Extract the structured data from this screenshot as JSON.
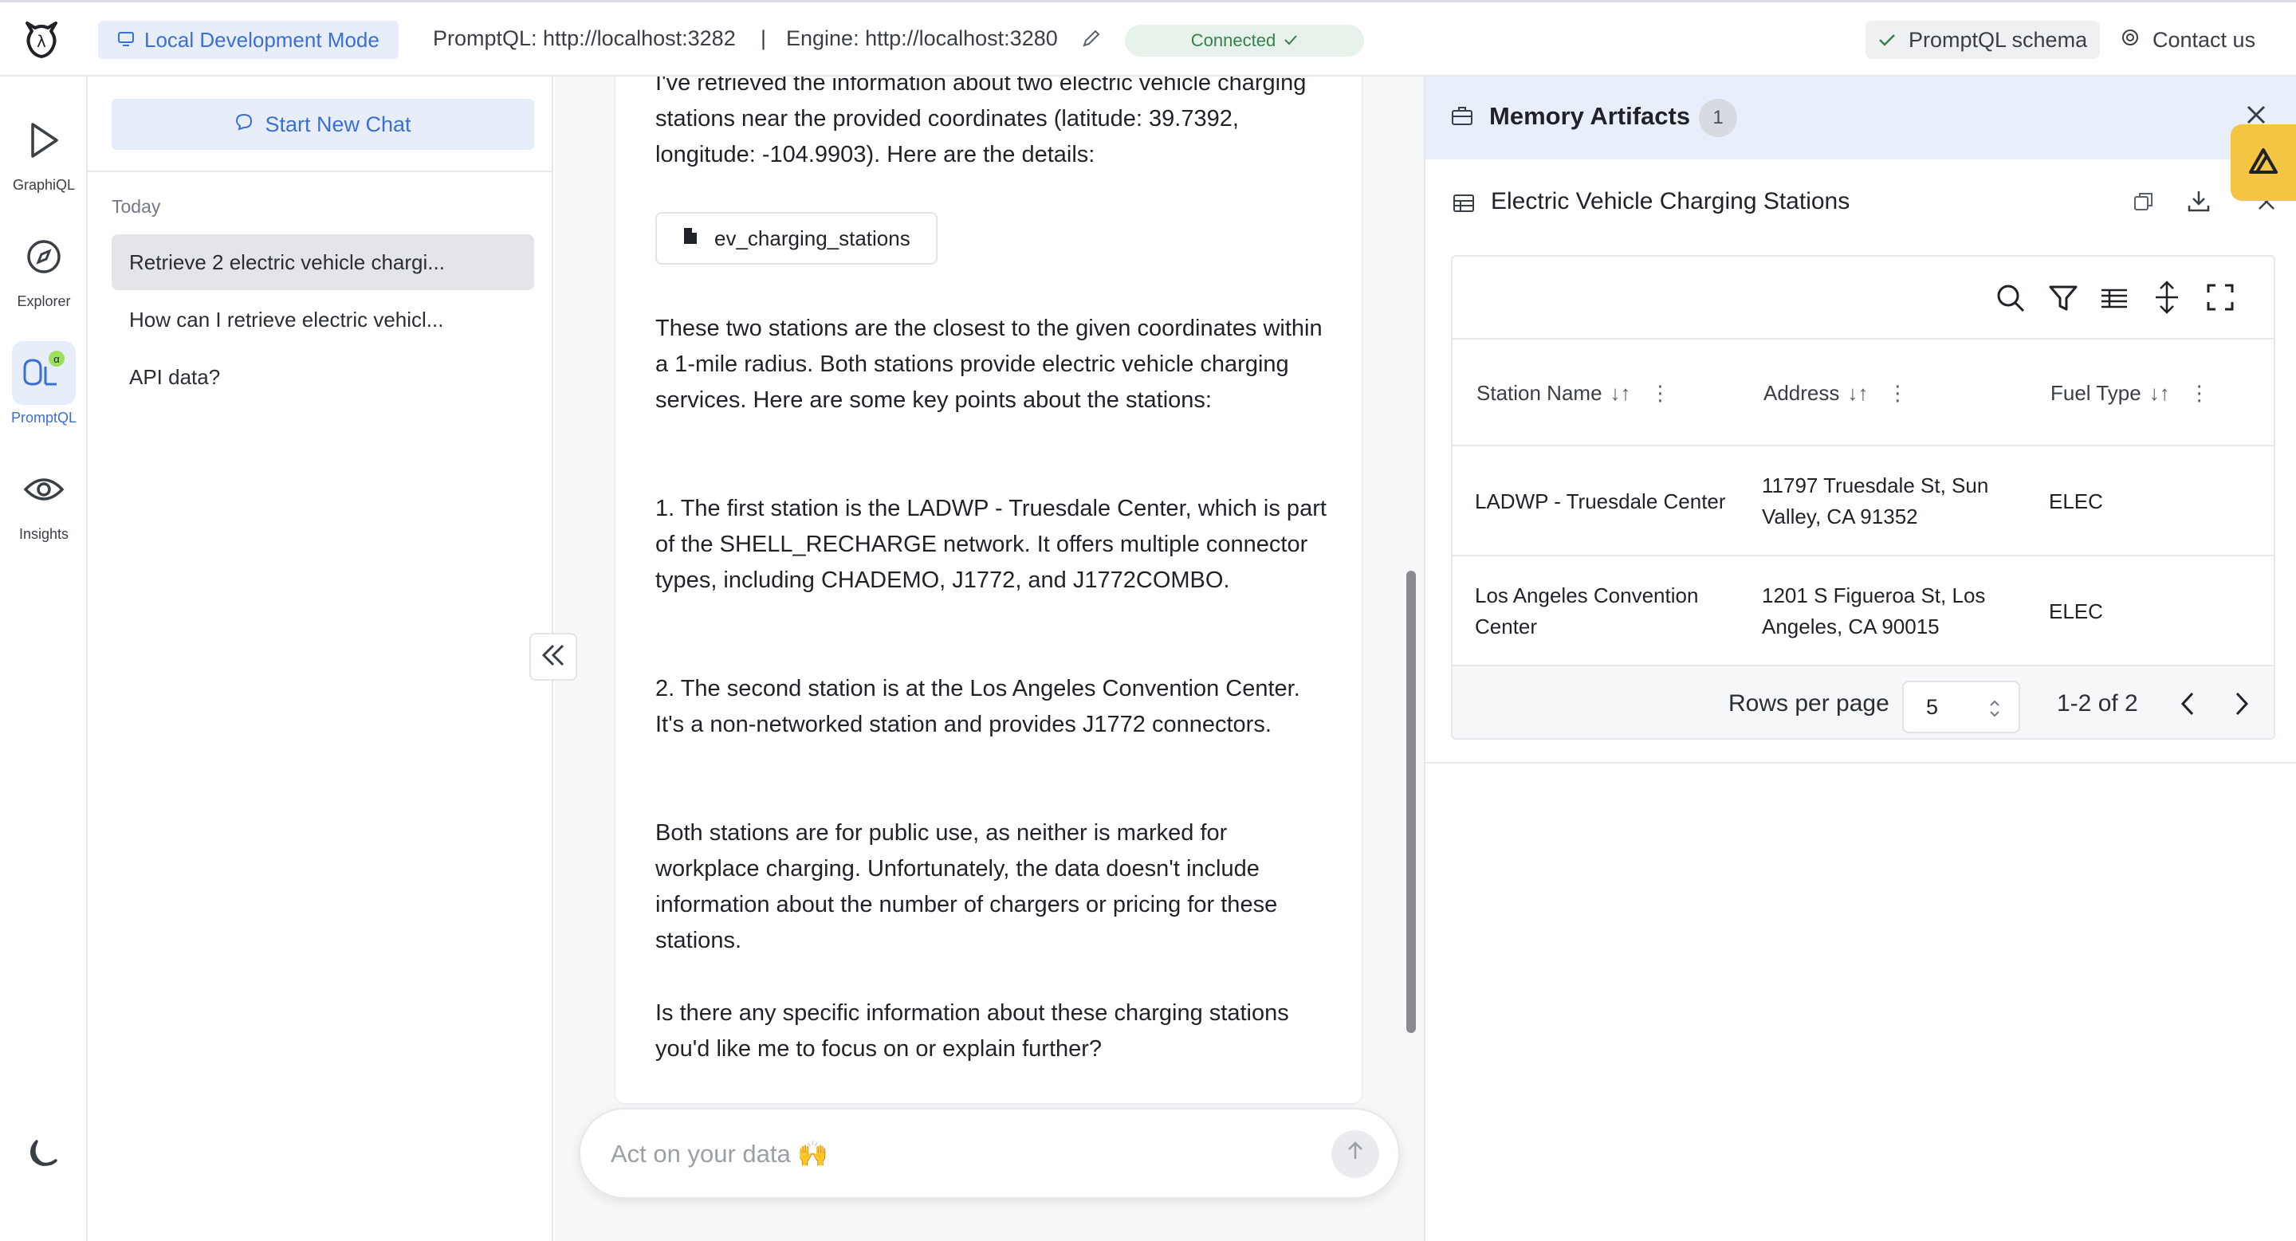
{
  "topbar": {
    "mode_label": "Local Development Mode",
    "promptql_url": "PromptQL: http://localhost:3282",
    "separator": "|",
    "engine_url": "Engine: http://localhost:3280",
    "status": "Connected",
    "schema_label": "PromptQL schema",
    "contact_label": "Contact us"
  },
  "nav": {
    "items": [
      {
        "label": "GraphiQL",
        "icon": "play-icon"
      },
      {
        "label": "Explorer",
        "icon": "compass-icon"
      },
      {
        "label": "PromptQL",
        "icon": "promptql-icon",
        "badge": "α"
      },
      {
        "label": "Insights",
        "icon": "eye-icon"
      }
    ],
    "theme_icon": "moon-icon"
  },
  "chatlist": {
    "new_chat_label": "Start New Chat",
    "section_label": "Today",
    "items": [
      {
        "label": "Retrieve 2 electric vehicle chargi..."
      },
      {
        "label": "How can I retrieve electric vehicl..."
      },
      {
        "label": "API data?"
      }
    ]
  },
  "message": {
    "intro_partial": "I've retrieved the information about two electric vehicle charging stations near the provided coordinates (latitude: 39.7392, longitude: -104.9903). Here are the details:",
    "artifact_chip": "ev_charging_stations",
    "p1": "These two stations are the closest to the given coordinates within a 1-mile radius. Both stations provide electric vehicle charging services. Here are some key points about the stations:",
    "p2": "1. The first station is the LADWP - Truesdale Center, which is part of the SHELL_RECHARGE network. It offers multiple connector types, including CHADEMO, J1772, and J1772COMBO.",
    "p3": "2. The second station is at the Los Angeles Convention Center. It's a non-networked station and provides J1772 connectors.",
    "p4": "Both stations are for public use, as neither is marked for workplace charging. Unfortunately, the data doesn't include information about the number of chargers or pricing for these stations.",
    "p5": "Is there any specific information about these charging stations you'd like me to focus on or explain further?"
  },
  "input": {
    "placeholder": "Act on your data 🙌"
  },
  "panel": {
    "title": "Memory Artifacts",
    "count": "1",
    "artifact_title": "Electric Vehicle Charging Stations",
    "columns": [
      "Station Name",
      "Address",
      "Fuel Type"
    ],
    "rows": [
      {
        "name": "LADWP - Truesdale Center",
        "address": "11797 Truesdale St, Sun Valley, CA 91352",
        "fuel": "ELEC"
      },
      {
        "name": "Los Angeles Convention Center",
        "address": "1201 S Figueroa St, Los Angeles, CA 90015",
        "fuel": "ELEC"
      }
    ],
    "rows_per_page_label": "Rows per page",
    "rows_per_page_value": "5",
    "page_info": "1-2 of 2",
    "sort_glyph": "↓↑"
  },
  "colors": {
    "accent": "#3b6fd4",
    "connected_green": "#35804f",
    "brand_yellow": "#f4c542"
  }
}
